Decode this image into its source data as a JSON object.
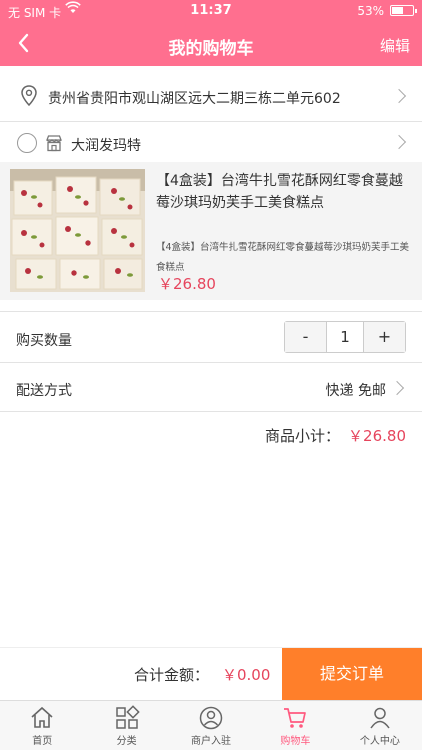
{
  "status": {
    "carrier": "无 SIM 卡",
    "time": "11:37",
    "battery": "53%",
    "battery_level": 0.53
  },
  "header": {
    "title": "我的购物车",
    "edit_label": "编辑"
  },
  "address": {
    "text": "贵州省贵阳市观山湖区远大二期三栋二单元602"
  },
  "store": {
    "name": "大润发玛特"
  },
  "product": {
    "title": "【4盒装】台湾牛扎雪花酥网红零食蔓越莓沙琪玛奶芙手工美食糕点",
    "subtitle": "【4盒装】台湾牛扎雪花酥网红零食蔓越莓沙琪玛奶芙手工美食糕点",
    "price": "￥26.80"
  },
  "quantity": {
    "label": "购买数量",
    "minus": "-",
    "value": "1",
    "plus": "+"
  },
  "delivery": {
    "label": "配送方式",
    "value": "快递 免邮"
  },
  "subtotal": {
    "label": "商品小计：",
    "value": "￥26.80"
  },
  "checkout": {
    "total_label": "合计金额：",
    "total_value": "￥0.00",
    "submit_label": "提交订单"
  },
  "tabs": [
    {
      "label": "首页",
      "icon": "home-icon"
    },
    {
      "label": "分类",
      "icon": "category-icon"
    },
    {
      "label": "商户入驻",
      "icon": "merchant-icon"
    },
    {
      "label": "购物车",
      "icon": "cart-icon",
      "active": true
    },
    {
      "label": "个人中心",
      "icon": "user-icon"
    }
  ],
  "colors": {
    "header": "#ff6f8f",
    "price": "#e6455d",
    "submit": "#ff7f2a",
    "active_tab": "#ff5a7f"
  }
}
